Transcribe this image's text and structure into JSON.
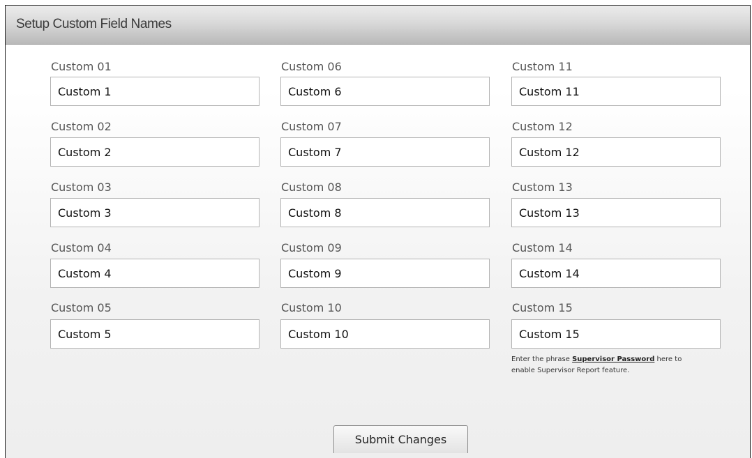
{
  "header": {
    "title": "Setup Custom Field Names"
  },
  "fields": [
    {
      "label": "Custom 01",
      "value": "Custom 1"
    },
    {
      "label": "Custom 02",
      "value": "Custom 2"
    },
    {
      "label": "Custom 03",
      "value": "Custom 3"
    },
    {
      "label": "Custom 04",
      "value": "Custom 4"
    },
    {
      "label": "Custom 05",
      "value": "Custom 5"
    },
    {
      "label": "Custom 06",
      "value": "Custom 6"
    },
    {
      "label": "Custom 07",
      "value": "Custom 7"
    },
    {
      "label": "Custom 08",
      "value": "Custom 8"
    },
    {
      "label": "Custom 09",
      "value": "Custom 9"
    },
    {
      "label": "Custom 10",
      "value": "Custom 10"
    },
    {
      "label": "Custom 11",
      "value": "Custom 11"
    },
    {
      "label": "Custom 12",
      "value": "Custom 12"
    },
    {
      "label": "Custom 13",
      "value": "Custom 13"
    },
    {
      "label": "Custom 14",
      "value": "Custom 14"
    },
    {
      "label": "Custom 15",
      "value": "Custom 15"
    }
  ],
  "note": {
    "before": "Enter the phrase ",
    "phrase": "Supervisor Password",
    "after": " here to enable Supervisor Report feature."
  },
  "submit_label": "Submit Changes"
}
